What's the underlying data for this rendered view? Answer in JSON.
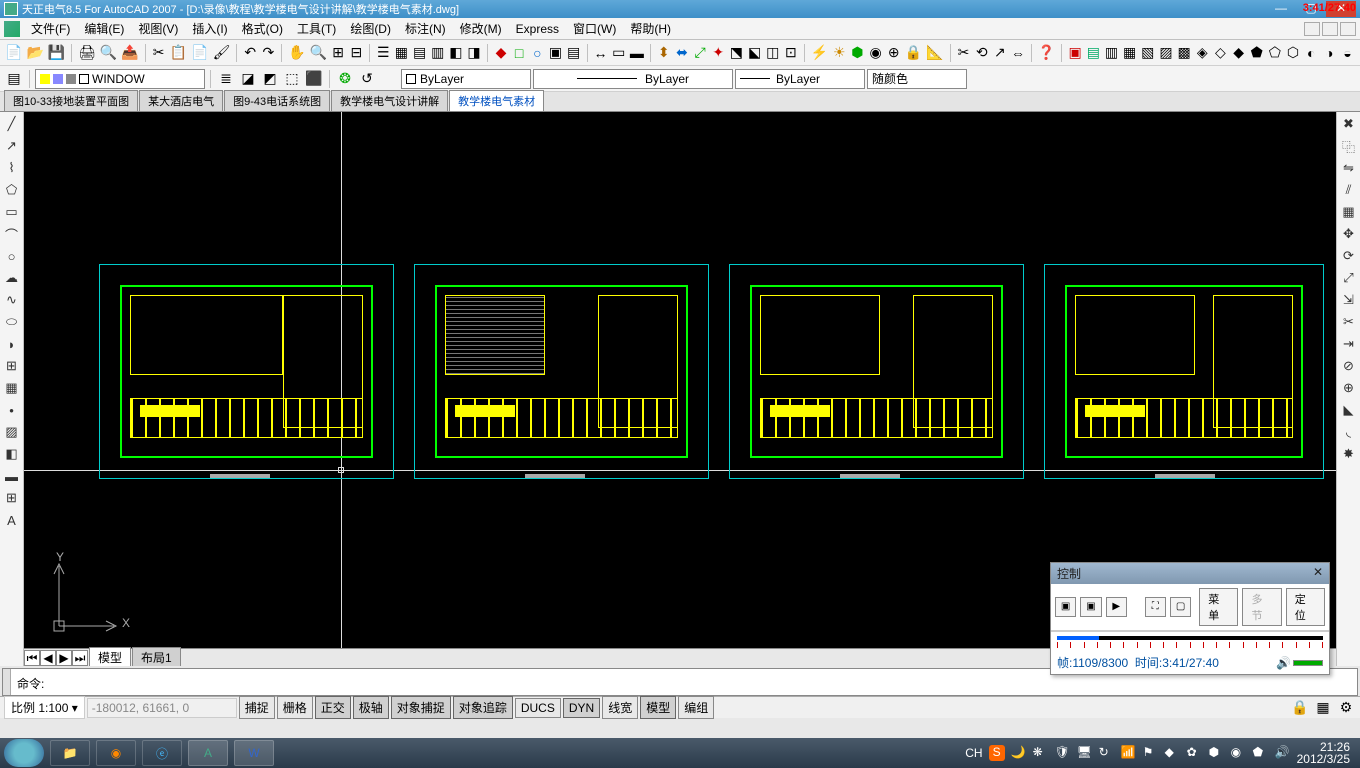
{
  "titlebar": {
    "title": "天正电气8.5 For AutoCAD 2007 - [D:\\录像\\教程\\教学楼电气设计讲解\\教学楼电气素材.dwg]"
  },
  "recorder_overlay": "3:41/27:40",
  "menu": {
    "items": [
      "文件(F)",
      "编辑(E)",
      "视图(V)",
      "插入(I)",
      "格式(O)",
      "工具(T)",
      "绘图(D)",
      "标注(N)",
      "修改(M)",
      "Express",
      "窗口(W)",
      "帮助(H)"
    ]
  },
  "layer_dropdown": {
    "value": "WINDOW"
  },
  "props": {
    "color_label": "ByLayer",
    "linetype": "ByLayer",
    "lineweight": "ByLayer",
    "plotstyle": "随颜色"
  },
  "doc_tabs": [
    {
      "label": "图10-33接地装置平面图",
      "active": false
    },
    {
      "label": "某大酒店电气",
      "active": false
    },
    {
      "label": "图9-43电话系统图",
      "active": false
    },
    {
      "label": "教学楼电气设计讲解",
      "active": false
    },
    {
      "label": "教学楼电气素材",
      "active": true
    }
  ],
  "ucs": {
    "y": "Y",
    "x": "X"
  },
  "layout_tabs": {
    "modelspace": "模型",
    "layout1": "布局1"
  },
  "control_panel": {
    "title": "控制",
    "btn_menu": "菜单",
    "btn_sect": "多节",
    "btn_locate": "定位",
    "frame_label": "帧:",
    "frame_value": "1109/8300",
    "time_label": "时间:",
    "time_value": "3:41/27:40"
  },
  "cmd": {
    "prompt": "命令:"
  },
  "status": {
    "scale": "比例 1:100 ▾",
    "coords": "-180012, 61661, 0",
    "toggles": [
      "捕捉",
      "栅格",
      "正交",
      "极轴",
      "对象捕捉",
      "对象追踪",
      "DUCS",
      "DYN",
      "线宽",
      "模型"
    ],
    "toggles_on": [
      false,
      false,
      true,
      true,
      true,
      true,
      false,
      true,
      false,
      true
    ],
    "edit": "编组"
  },
  "tray": {
    "ime": "CH",
    "time": "21:26",
    "date": "2012/3/25"
  }
}
